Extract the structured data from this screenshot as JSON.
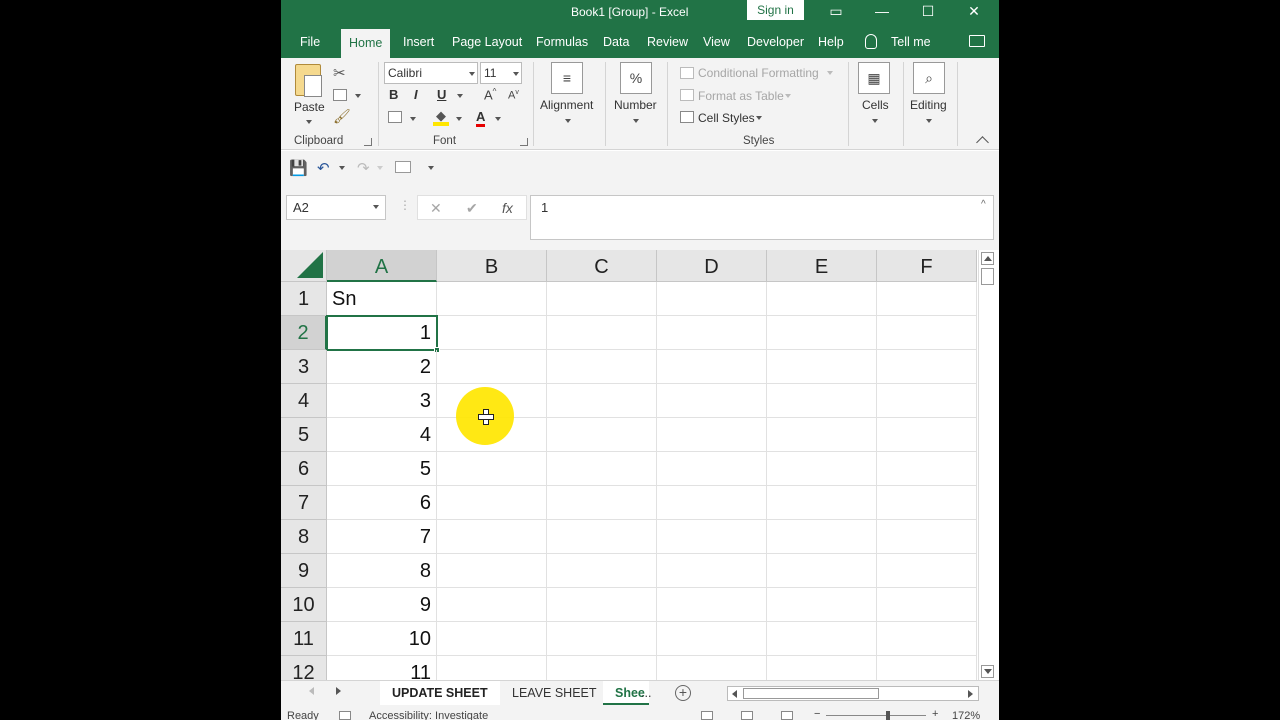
{
  "window": {
    "title": "Book1  [Group]  -  Excel",
    "sign_in": "Sign in",
    "controls": [
      "restore-ribbon-icon",
      "minimize-icon",
      "maximize-icon",
      "close-icon"
    ]
  },
  "ribbon_tabs": [
    "File",
    "Home",
    "Insert",
    "Page Layout",
    "Formulas",
    "Data",
    "Review",
    "View",
    "Developer",
    "Help",
    "Tell me"
  ],
  "active_tab": "Home",
  "ribbon": {
    "clipboard": {
      "paste": "Paste",
      "label": "Clipboard"
    },
    "font": {
      "family": "Calibri",
      "size": "11",
      "bold": "B",
      "italic": "I",
      "underline": "U",
      "font_color": "A",
      "label": "Font"
    },
    "alignment": {
      "label": "Alignment"
    },
    "number": {
      "label": "Number",
      "icon_text": "%"
    },
    "styles": {
      "conditional_formatting": "Conditional Formatting",
      "format_as_table": "Format as Table",
      "cell_styles": "Cell Styles",
      "label": "Styles"
    },
    "cells": {
      "label": "Cells"
    },
    "editing": {
      "label": "Editing"
    }
  },
  "formula_bar": {
    "name_box": "A2",
    "cancel": "✕",
    "enter": "✔",
    "fx": "fx",
    "value": "1"
  },
  "grid": {
    "columns": [
      "A",
      "B",
      "C",
      "D",
      "E",
      "F"
    ],
    "selected_column": "A",
    "rows": [
      {
        "num": "1",
        "a": "Sn"
      },
      {
        "num": "2",
        "a": "1"
      },
      {
        "num": "3",
        "a": "2"
      },
      {
        "num": "4",
        "a": "3"
      },
      {
        "num": "5",
        "a": "4"
      },
      {
        "num": "6",
        "a": "5"
      },
      {
        "num": "7",
        "a": "6"
      },
      {
        "num": "8",
        "a": "7"
      },
      {
        "num": "9",
        "a": "8"
      },
      {
        "num": "10",
        "a": "9"
      },
      {
        "num": "11",
        "a": "10"
      },
      {
        "num": "12",
        "a": "11"
      }
    ],
    "active_cell": "A2"
  },
  "sheets": {
    "tabs": [
      "UPDATE SHEET",
      "LEAVE SHEET",
      "Shee"
    ],
    "ellipsis": "...",
    "add": "+"
  },
  "status": {
    "ready": "Ready",
    "accessibility": "Accessibility: Investigate",
    "zoom": "172%"
  },
  "colors": {
    "accent": "#217346",
    "cursor_highlight": "#ffe600"
  }
}
